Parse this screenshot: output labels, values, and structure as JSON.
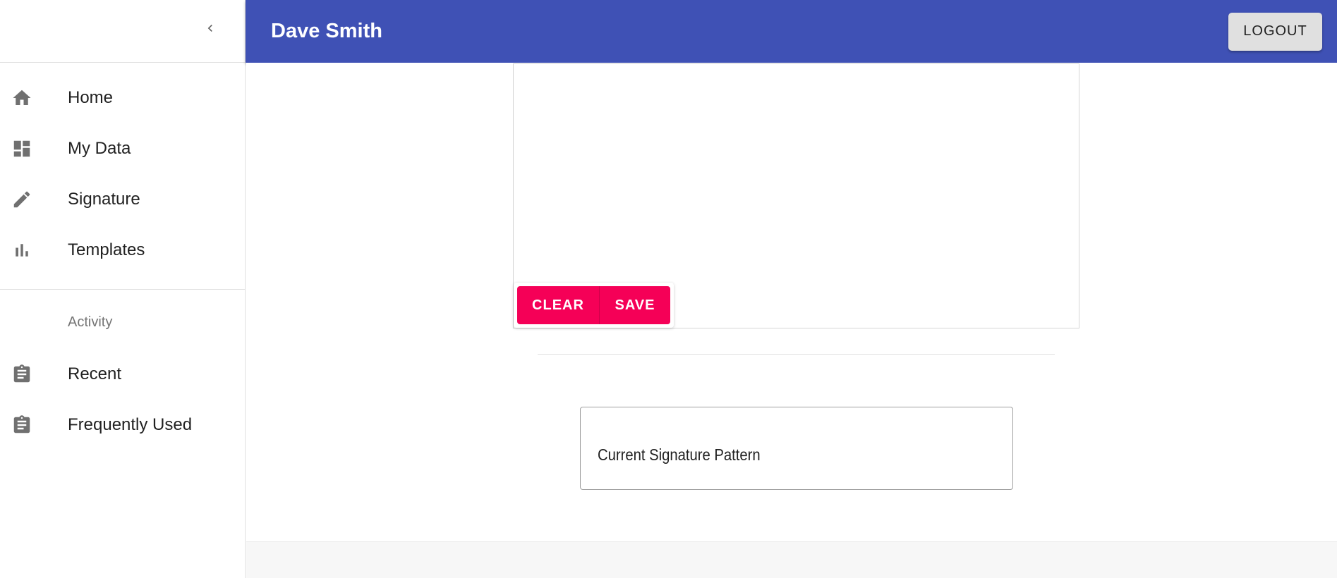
{
  "header": {
    "user_name": "Dave Smith",
    "logout_label": "LOGOUT",
    "background_color": "#3f51b5"
  },
  "sidebar": {
    "items": [
      {
        "label": "Home",
        "icon": "home-icon"
      },
      {
        "label": "My Data",
        "icon": "dashboard-icon"
      },
      {
        "label": "Signature",
        "icon": "pencil-icon"
      },
      {
        "label": "Templates",
        "icon": "bar-chart-icon"
      }
    ],
    "activity_header": "Activity",
    "activity_items": [
      {
        "label": "Recent",
        "icon": "clipboard-icon"
      },
      {
        "label": "Frequently Used",
        "icon": "clipboard-icon"
      }
    ]
  },
  "signature_pad": {
    "clear_label": "CLEAR",
    "save_label": "SAVE",
    "button_color": "#f50057"
  },
  "current_signature": {
    "label": "Current Signature Pattern"
  }
}
